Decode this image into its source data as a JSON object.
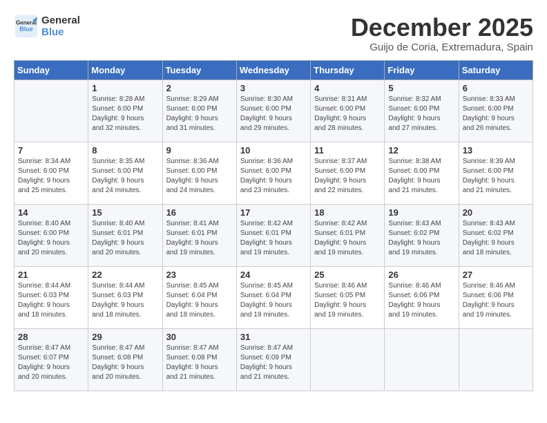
{
  "header": {
    "logo_line1": "General",
    "logo_line2": "Blue",
    "month_title": "December 2025",
    "location": "Guijo de Coria, Extremadura, Spain"
  },
  "days_of_week": [
    "Sunday",
    "Monday",
    "Tuesday",
    "Wednesday",
    "Thursday",
    "Friday",
    "Saturday"
  ],
  "weeks": [
    [
      {
        "day": "",
        "content": ""
      },
      {
        "day": "1",
        "content": "Sunrise: 8:28 AM\nSunset: 6:00 PM\nDaylight: 9 hours\nand 32 minutes."
      },
      {
        "day": "2",
        "content": "Sunrise: 8:29 AM\nSunset: 6:00 PM\nDaylight: 9 hours\nand 31 minutes."
      },
      {
        "day": "3",
        "content": "Sunrise: 8:30 AM\nSunset: 6:00 PM\nDaylight: 9 hours\nand 29 minutes."
      },
      {
        "day": "4",
        "content": "Sunrise: 8:31 AM\nSunset: 6:00 PM\nDaylight: 9 hours\nand 28 minutes."
      },
      {
        "day": "5",
        "content": "Sunrise: 8:32 AM\nSunset: 6:00 PM\nDaylight: 9 hours\nand 27 minutes."
      },
      {
        "day": "6",
        "content": "Sunrise: 8:33 AM\nSunset: 6:00 PM\nDaylight: 9 hours\nand 26 minutes."
      }
    ],
    [
      {
        "day": "7",
        "content": "Sunrise: 8:34 AM\nSunset: 6:00 PM\nDaylight: 9 hours\nand 25 minutes."
      },
      {
        "day": "8",
        "content": "Sunrise: 8:35 AM\nSunset: 6:00 PM\nDaylight: 9 hours\nand 24 minutes."
      },
      {
        "day": "9",
        "content": "Sunrise: 8:36 AM\nSunset: 6:00 PM\nDaylight: 9 hours\nand 24 minutes."
      },
      {
        "day": "10",
        "content": "Sunrise: 8:36 AM\nSunset: 6:00 PM\nDaylight: 9 hours\nand 23 minutes."
      },
      {
        "day": "11",
        "content": "Sunrise: 8:37 AM\nSunset: 6:00 PM\nDaylight: 9 hours\nand 22 minutes."
      },
      {
        "day": "12",
        "content": "Sunrise: 8:38 AM\nSunset: 6:00 PM\nDaylight: 9 hours\nand 21 minutes."
      },
      {
        "day": "13",
        "content": "Sunrise: 8:39 AM\nSunset: 6:00 PM\nDaylight: 9 hours\nand 21 minutes."
      }
    ],
    [
      {
        "day": "14",
        "content": "Sunrise: 8:40 AM\nSunset: 6:00 PM\nDaylight: 9 hours\nand 20 minutes."
      },
      {
        "day": "15",
        "content": "Sunrise: 8:40 AM\nSunset: 6:01 PM\nDaylight: 9 hours\nand 20 minutes."
      },
      {
        "day": "16",
        "content": "Sunrise: 8:41 AM\nSunset: 6:01 PM\nDaylight: 9 hours\nand 19 minutes."
      },
      {
        "day": "17",
        "content": "Sunrise: 8:42 AM\nSunset: 6:01 PM\nDaylight: 9 hours\nand 19 minutes."
      },
      {
        "day": "18",
        "content": "Sunrise: 8:42 AM\nSunset: 6:01 PM\nDaylight: 9 hours\nand 19 minutes."
      },
      {
        "day": "19",
        "content": "Sunrise: 8:43 AM\nSunset: 6:02 PM\nDaylight: 9 hours\nand 19 minutes."
      },
      {
        "day": "20",
        "content": "Sunrise: 8:43 AM\nSunset: 6:02 PM\nDaylight: 9 hours\nand 18 minutes."
      }
    ],
    [
      {
        "day": "21",
        "content": "Sunrise: 8:44 AM\nSunset: 6:03 PM\nDaylight: 9 hours\nand 18 minutes."
      },
      {
        "day": "22",
        "content": "Sunrise: 8:44 AM\nSunset: 6:03 PM\nDaylight: 9 hours\nand 18 minutes."
      },
      {
        "day": "23",
        "content": "Sunrise: 8:45 AM\nSunset: 6:04 PM\nDaylight: 9 hours\nand 18 minutes."
      },
      {
        "day": "24",
        "content": "Sunrise: 8:45 AM\nSunset: 6:04 PM\nDaylight: 9 hours\nand 19 minutes."
      },
      {
        "day": "25",
        "content": "Sunrise: 8:46 AM\nSunset: 6:05 PM\nDaylight: 9 hours\nand 19 minutes."
      },
      {
        "day": "26",
        "content": "Sunrise: 8:46 AM\nSunset: 6:06 PM\nDaylight: 9 hours\nand 19 minutes."
      },
      {
        "day": "27",
        "content": "Sunrise: 8:46 AM\nSunset: 6:06 PM\nDaylight: 9 hours\nand 19 minutes."
      }
    ],
    [
      {
        "day": "28",
        "content": "Sunrise: 8:47 AM\nSunset: 6:07 PM\nDaylight: 9 hours\nand 20 minutes."
      },
      {
        "day": "29",
        "content": "Sunrise: 8:47 AM\nSunset: 6:08 PM\nDaylight: 9 hours\nand 20 minutes."
      },
      {
        "day": "30",
        "content": "Sunrise: 8:47 AM\nSunset: 6:08 PM\nDaylight: 9 hours\nand 21 minutes."
      },
      {
        "day": "31",
        "content": "Sunrise: 8:47 AM\nSunset: 6:09 PM\nDaylight: 9 hours\nand 21 minutes."
      },
      {
        "day": "",
        "content": ""
      },
      {
        "day": "",
        "content": ""
      },
      {
        "day": "",
        "content": ""
      }
    ]
  ]
}
